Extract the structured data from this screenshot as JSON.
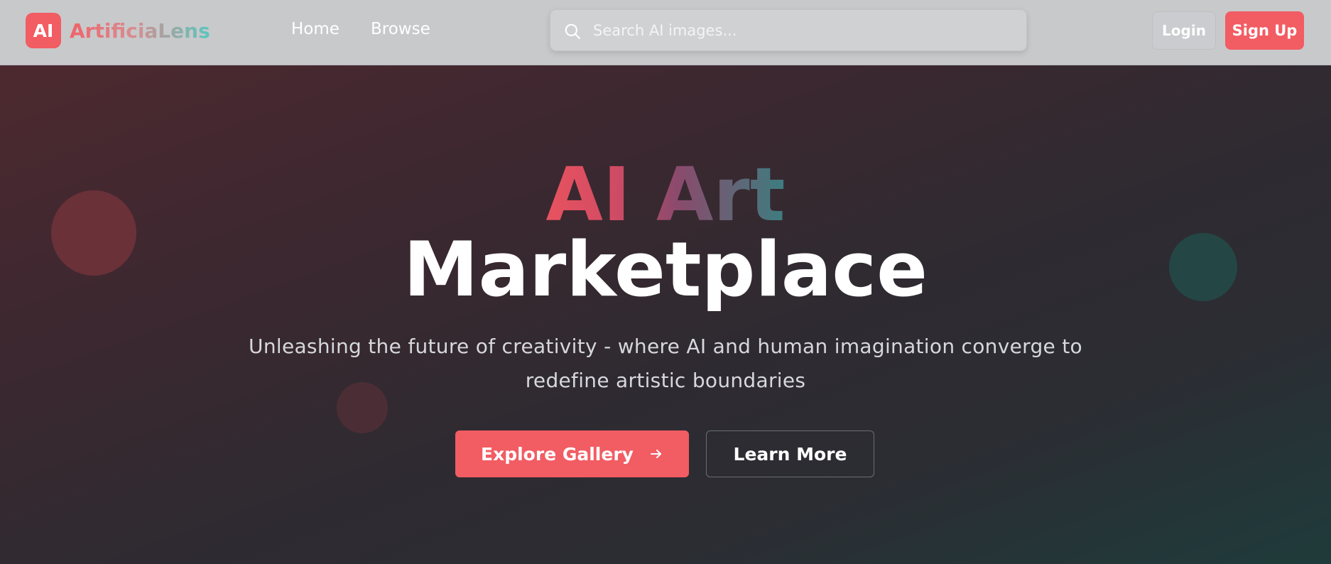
{
  "brand": {
    "badge": "AI",
    "name": "ArtificiaLens",
    "accent_color": "#f25c63"
  },
  "nav": {
    "items": [
      {
        "label": "Home"
      },
      {
        "label": "Browse"
      }
    ]
  },
  "search": {
    "placeholder": "Search AI images...",
    "icon": "search-icon"
  },
  "auth": {
    "login_label": "Login",
    "signup_label": "Sign Up"
  },
  "hero": {
    "title_highlight": "AI Art",
    "title_main": "Marketplace",
    "subtitle": "Unleashing the future of creativity - where AI and human imagination converge to redefine artistic boundaries",
    "primary_cta": "Explore Gallery",
    "primary_cta_icon": "arrow-right-icon",
    "secondary_cta": "Learn More",
    "colors": {
      "gradient_start": "#e8535f",
      "gradient_end": "#3d7d80"
    }
  }
}
